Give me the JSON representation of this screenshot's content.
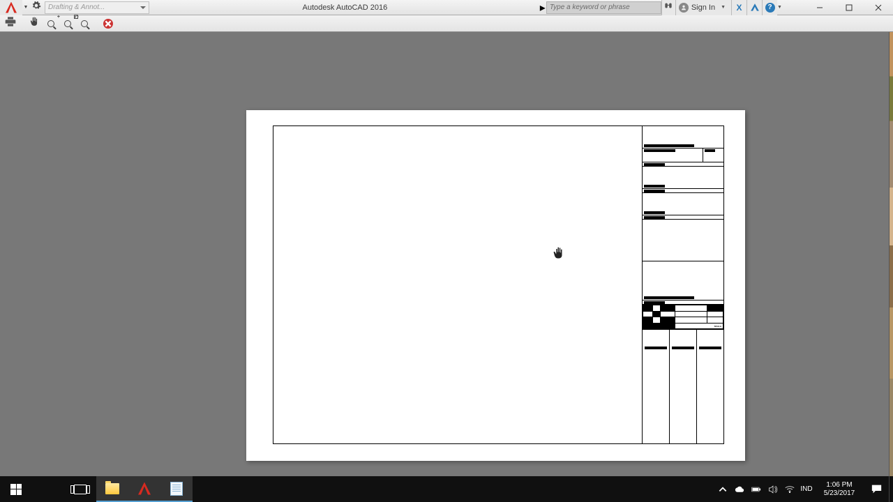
{
  "app": {
    "title": "Autodesk AutoCAD 2016",
    "workspace_placeholder": "Drafting & Annot..."
  },
  "search": {
    "placeholder": "Type a keyword or phrase"
  },
  "signin": {
    "label": "Sign In"
  },
  "titleblock": {
    "scale_label": "SKALA"
  },
  "tray": {
    "lang": "IND",
    "time": "1:06 PM",
    "date": "5/23/2017"
  }
}
